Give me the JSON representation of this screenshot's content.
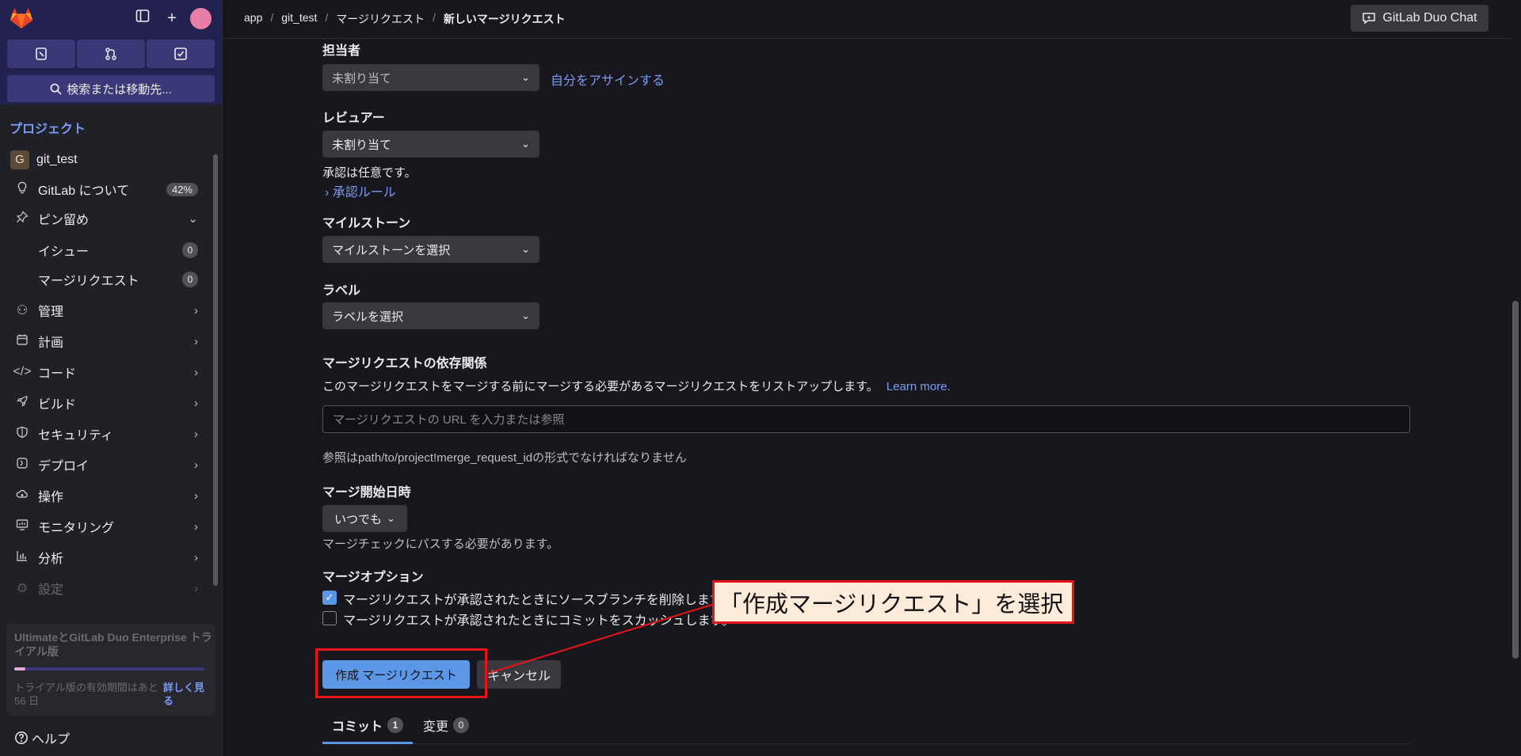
{
  "sidebar": {
    "project_title": "プロジェクト",
    "search_label": "検索または移動先...",
    "project": {
      "initial": "G",
      "name": "git_test"
    },
    "about": {
      "label": "GitLab について",
      "percent": "42%"
    },
    "pinned": {
      "label": "ピン留め",
      "items": [
        {
          "label": "イシュー",
          "count": "0"
        },
        {
          "label": "マージリクエスト",
          "count": "0"
        }
      ]
    },
    "menu": [
      {
        "label": "管理"
      },
      {
        "label": "計画"
      },
      {
        "label": "コード"
      },
      {
        "label": "ビルド"
      },
      {
        "label": "セキュリティ"
      },
      {
        "label": "デプロイ"
      },
      {
        "label": "操作"
      },
      {
        "label": "モニタリング"
      },
      {
        "label": "分析"
      },
      {
        "label": "設定"
      }
    ],
    "trial": {
      "title": "UltimateとGitLab Duo Enterprise トライアル版",
      "progress": 0.06,
      "remaining": "トライアル版の有効期間はあと 56 日",
      "link": "詳しく見る"
    },
    "help": "ヘルプ"
  },
  "topbar": {
    "breadcrumbs": [
      "app",
      "git_test",
      "マージリクエスト",
      "新しいマージリクエスト"
    ],
    "duo_chat": "GitLab Duo Chat"
  },
  "form": {
    "assignee": {
      "label": "担当者",
      "value": "未割り当て",
      "assign_self": "自分をアサインする"
    },
    "reviewer": {
      "label": "レビュアー",
      "value": "未割り当て",
      "note": "承認は任意です。",
      "rules_link": "承認ルール"
    },
    "milestone": {
      "label": "マイルストーン",
      "value": "マイルストーンを選択"
    },
    "labels": {
      "label": "ラベル",
      "value": "ラベルを選択"
    },
    "dependencies": {
      "label": "マージリクエストの依存関係",
      "description": "このマージリクエストをマージする前にマージする必要があるマージリクエストをリストアップします。",
      "learn_more": "Learn more.",
      "placeholder": "マージリクエストの URL を入力または参照",
      "help": "参照はpath/to/project!merge_request_idの形式でなければなりません"
    },
    "merge_after": {
      "label": "マージ開始日時",
      "value": "いつでも",
      "note": "マージチェックにパスする必要があります。"
    },
    "merge_options": {
      "label": "マージオプション",
      "delete_branch": {
        "label": "マージリクエストが承認されたときにソースブランチを削除します。",
        "checked": true
      },
      "squash": {
        "label": "マージリクエストが承認されたときにコミットをスカッシュします。",
        "checked": false
      }
    },
    "create_button": "作成 マージリクエスト",
    "cancel_button": "キャンセル",
    "tabs": [
      {
        "label": "コミット",
        "count": "1"
      },
      {
        "label": "変更",
        "count": "0"
      }
    ]
  },
  "annotation": {
    "callout": "「作成マージリクエスト」を選択"
  }
}
